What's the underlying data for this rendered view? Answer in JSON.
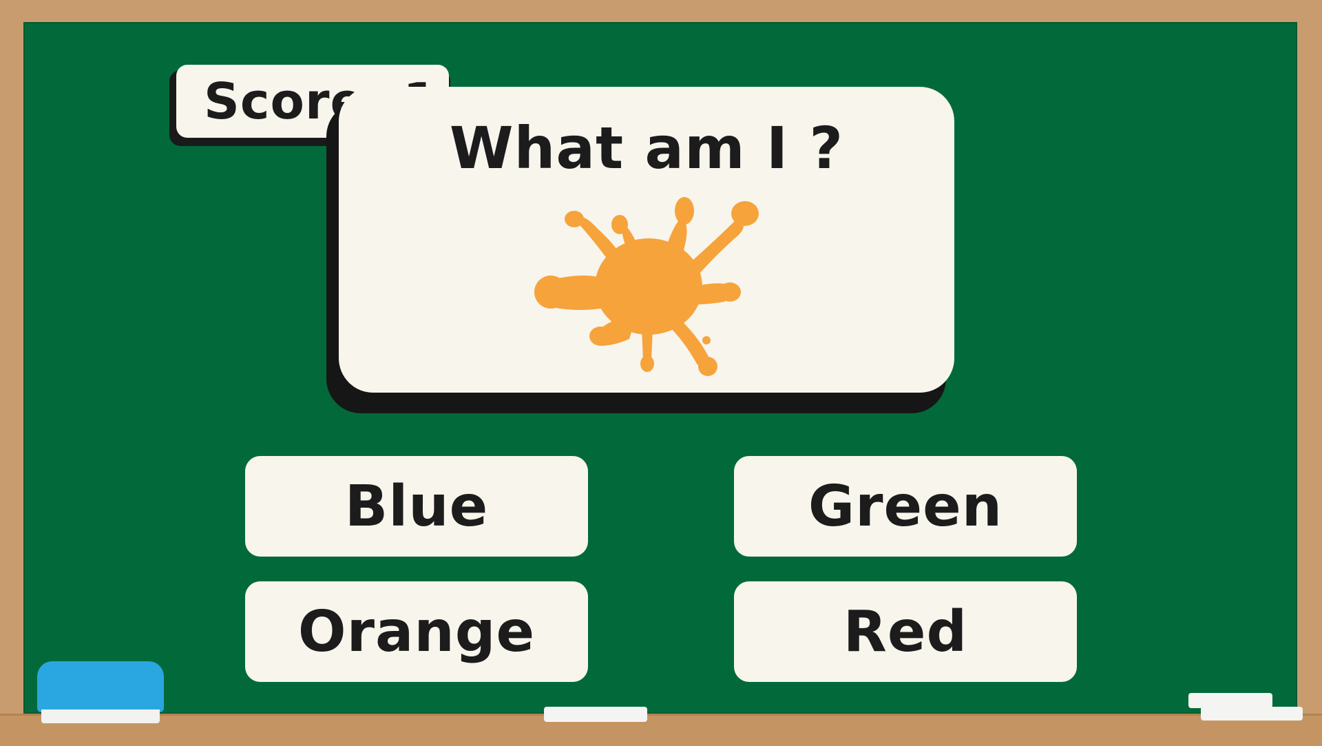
{
  "score": {
    "label": "Score: 1"
  },
  "question": {
    "title": "What am I ?",
    "image_icon": "orange-paint-splat-icon",
    "splat_color": "#f6a33b"
  },
  "answers": [
    {
      "id": "blue",
      "label": "Blue"
    },
    {
      "id": "green",
      "label": "Green"
    },
    {
      "id": "orange",
      "label": "Orange"
    },
    {
      "id": "red",
      "label": "Red"
    }
  ],
  "colors": {
    "board": "#026a3a",
    "frame": "#c89c6e",
    "card": "#f7f5ec",
    "text": "#1c1c1c",
    "eraser": "#2aa6e0"
  }
}
